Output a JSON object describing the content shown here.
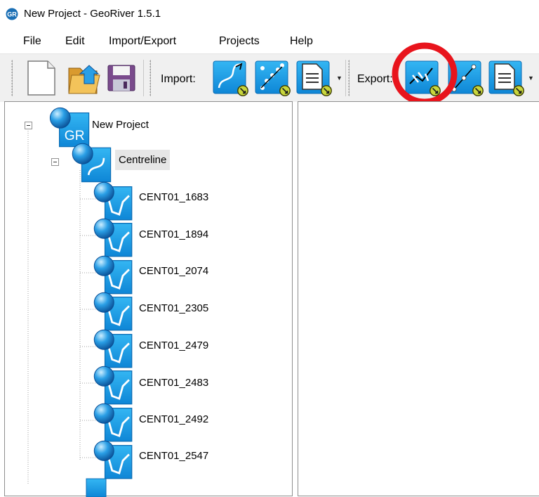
{
  "window": {
    "title": "New Project - GeoRiver 1.5.1",
    "app_icon_text": "GR"
  },
  "menu": {
    "items": [
      "File",
      "Edit",
      "Import/Export",
      "Projects",
      "Help"
    ]
  },
  "toolbar": {
    "import_label": "Import:",
    "export_label": "Export:",
    "buttons": {
      "new": "new-document-icon",
      "open": "open-folder-icon",
      "save": "save-disk-icon",
      "import_centreline": "import-centreline-icon",
      "import_points": "import-points-icon",
      "import_file": "import-file-icon",
      "export_centreline": "export-centreline-icon",
      "export_line": "export-line-icon",
      "export_file": "export-file-icon"
    },
    "highlight_color": "#e8141c"
  },
  "tree": {
    "root": {
      "label": "New Project",
      "icon_text": "GR"
    },
    "group": {
      "label": "Centreline"
    },
    "items": [
      "CENT01_1683",
      "CENT01_1894",
      "CENT01_2074",
      "CENT01_2305",
      "CENT01_2479",
      "CENT01_2483",
      "CENT01_2492",
      "CENT01_2547"
    ]
  },
  "colors": {
    "icon_blue": "#1fa3e8",
    "icon_dark": "#0b63a8",
    "accent_green": "#c8d63c"
  }
}
